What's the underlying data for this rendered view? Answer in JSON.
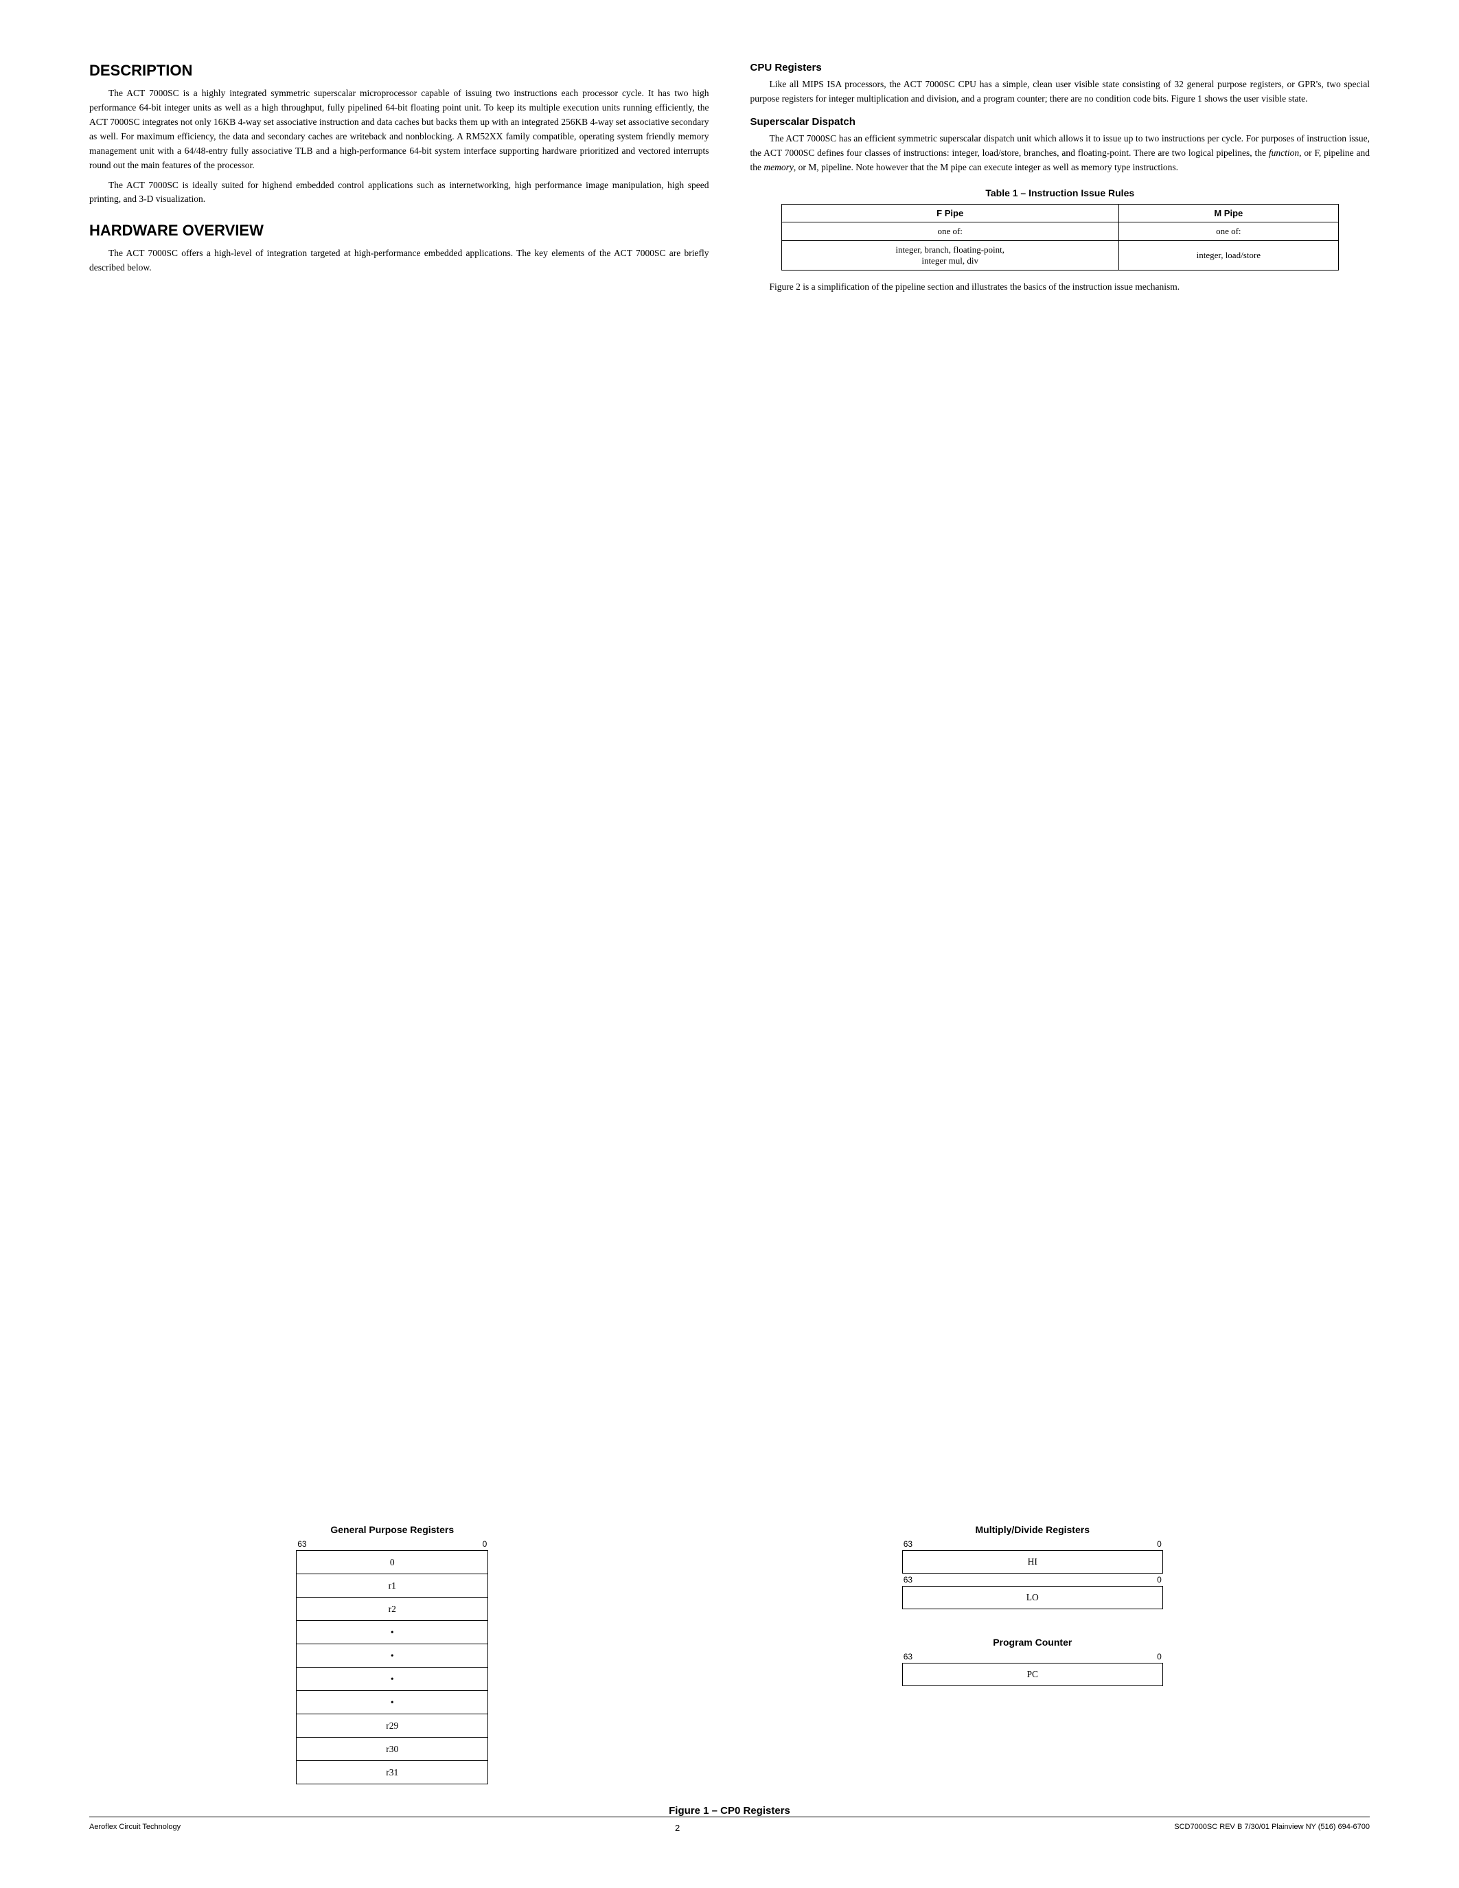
{
  "page": {
    "number": "2"
  },
  "footer": {
    "left": "Aeroflex Circuit Technology",
    "right": "SCD7000SC REV B  7/30/01  Plainview NY (516) 694-6700"
  },
  "sections": {
    "description": {
      "title": "DESCRIPTION",
      "paragraphs": [
        "The ACT 7000SC is a highly integrated symmetric superscalar microprocessor capable of issuing two instructions each processor cycle. It has two high performance 64-bit integer units as well as a high throughput, fully pipelined 64-bit floating point unit. To keep its multiple execution units running efficiently, the ACT 7000SC integrates not only 16KB 4-way set associative instruction and data caches but backs them up with an integrated 256KB 4-way set associative secondary as well. For maximum efficiency, the data and secondary caches are writeback and nonblocking. A RM52XX family compatible, operating system friendly memory management unit with a 64/48-entry fully associative TLB and a high-performance 64-bit system interface supporting hardware prioritized and vectored interrupts round out the main features of the processor.",
        "The ACT 7000SC is ideally suited for highend embedded control applications such as internetworking, high performance image manipulation, high speed printing, and 3-D visualization."
      ]
    },
    "hardware_overview": {
      "title": "HARDWARE OVERVIEW",
      "paragraphs": [
        "The ACT 7000SC offers a high-level of integration targeted at high-performance embedded applications. The key elements of the ACT 7000SC are briefly described below."
      ]
    },
    "cpu_registers": {
      "title": "CPU Registers",
      "paragraphs": [
        "Like all MIPS ISA processors, the ACT 7000SC CPU has a simple, clean user visible state consisting of 32 general purpose registers, or GPR's, two special purpose registers for integer multiplication and division, and a program counter; there are no condition code bits. Figure 1 shows the user visible state."
      ]
    },
    "superscalar_dispatch": {
      "title": "Superscalar Dispatch",
      "paragraphs": [
        "The ACT 7000SC has an efficient symmetric superscalar dispatch unit which allows it to issue up to two instructions per cycle. For purposes of instruction issue, the ACT 7000SC defines four classes of instructions: integer, load/store, branches, and floating-point. There are two logical pipelines, the function, or F, pipeline and the memory, or M, pipeline. Note however that the M pipe can execute integer as well as memory type instructions."
      ]
    },
    "table": {
      "title": "Table 1 – Instruction Issue Rules",
      "headers": [
        "F Pipe",
        "M Pipe"
      ],
      "rows": [
        [
          "one of:",
          "one of:"
        ],
        [
          "integer, branch, floating-point,\ninteger mul, div",
          "integer, load/store"
        ]
      ]
    },
    "table_note": "Figure 2 is a simplification of the pipeline section and illustrates the basics of the instruction issue mechanism.",
    "figure": {
      "caption": "Figure 1 – CP0 Registers",
      "gpr": {
        "title": "General Purpose Registers",
        "bit_high": "63",
        "bit_low": "0",
        "rows": [
          "0",
          "r1",
          "r2",
          "•",
          "•",
          "•",
          "•",
          "r29",
          "r30",
          "r31"
        ]
      },
      "multiply_divide": {
        "title": "Multiply/Divide Registers",
        "hi": {
          "bit_high": "63",
          "bit_low": "0",
          "label": "HI"
        },
        "lo": {
          "bit_high": "63",
          "bit_low": "0",
          "label": "LO"
        }
      },
      "program_counter": {
        "title": "Program Counter",
        "bit_high": "63",
        "bit_low": "0",
        "label": "PC"
      }
    }
  }
}
